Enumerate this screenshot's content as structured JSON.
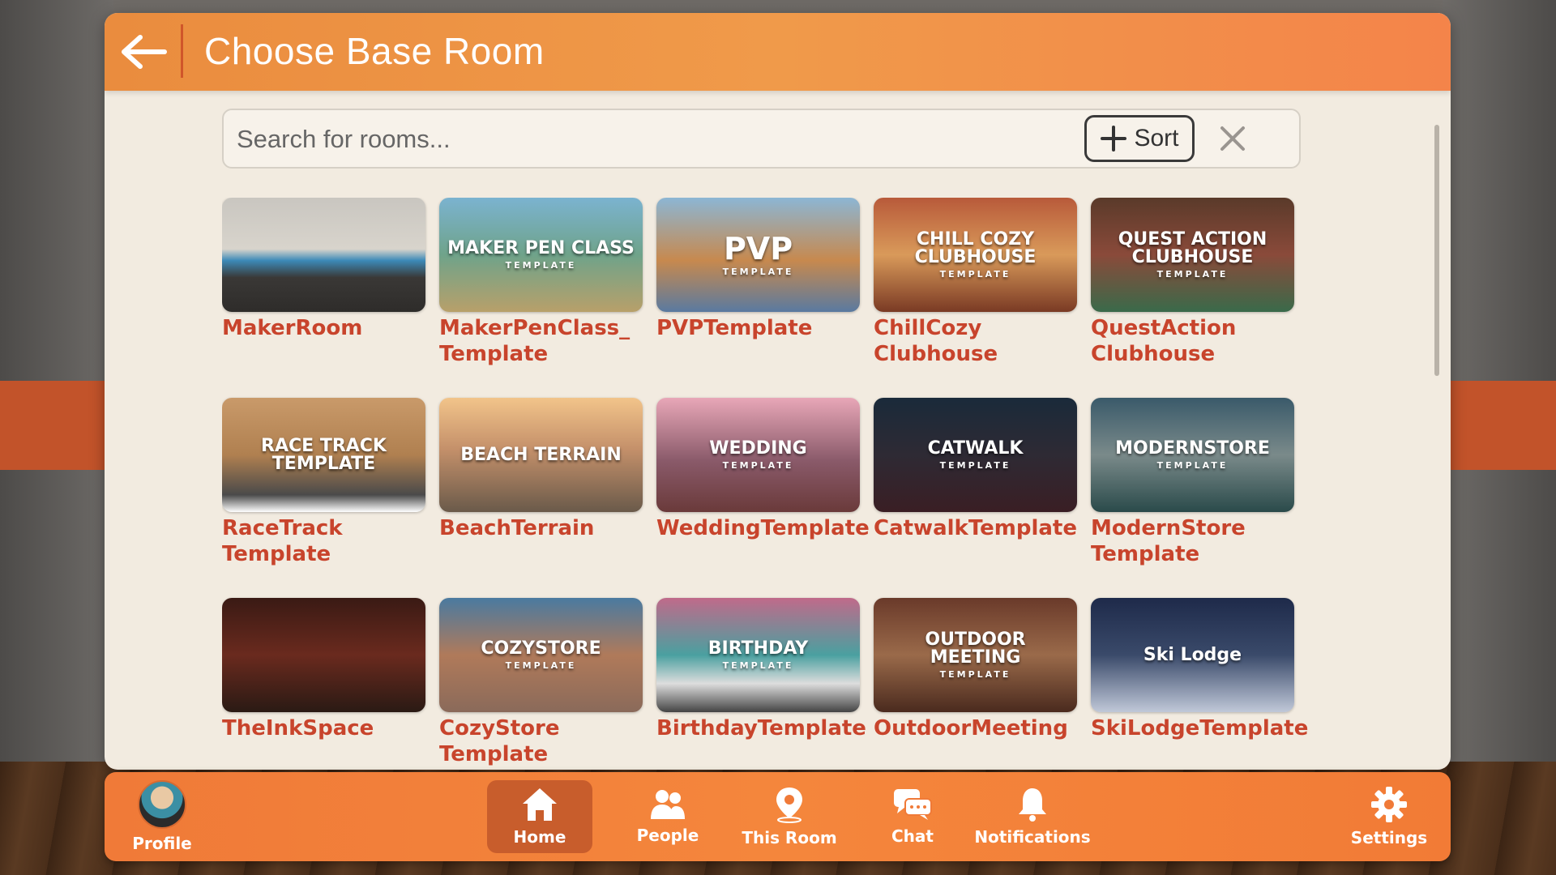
{
  "header": {
    "title": "Choose Base Room"
  },
  "search": {
    "placeholder": "Search for rooms...",
    "sort_label": "Sort"
  },
  "rooms": [
    {
      "name": "MakerRoom",
      "thumb_lines": [],
      "thumb_small": ""
    },
    {
      "name": "MakerPenClass_\nTemplate",
      "thumb_lines": [
        "MAKER PEN CLASS"
      ],
      "thumb_small": "TEMPLATE"
    },
    {
      "name": "PVPTemplate",
      "thumb_lines": [
        "PVP"
      ],
      "thumb_small": "TEMPLATE"
    },
    {
      "name": "ChillCozy\nClubhouse",
      "thumb_lines": [
        "CHILL COZY",
        "CLUBHOUSE"
      ],
      "thumb_small": "TEMPLATE"
    },
    {
      "name": "QuestAction\nClubhouse",
      "thumb_lines": [
        "QUEST ACTION",
        "CLUBHOUSE"
      ],
      "thumb_small": "TEMPLATE"
    },
    {
      "name": "RaceTrack\nTemplate",
      "thumb_lines": [
        "RACE TRACK",
        "TEMPLATE"
      ],
      "thumb_small": ""
    },
    {
      "name": "BeachTerrain",
      "thumb_lines": [
        "BEACH TERRAIN"
      ],
      "thumb_small": ""
    },
    {
      "name": "WeddingTemplate",
      "thumb_lines": [
        "WEDDING"
      ],
      "thumb_small": "TEMPLATE"
    },
    {
      "name": "CatwalkTemplate",
      "thumb_lines": [
        "CATWALK"
      ],
      "thumb_small": "TEMPLATE"
    },
    {
      "name": "ModernStore\nTemplate",
      "thumb_lines": [
        "MODERNSTORE"
      ],
      "thumb_small": "TEMPLATE"
    },
    {
      "name": "TheInkSpace",
      "thumb_lines": [],
      "thumb_small": ""
    },
    {
      "name": "CozyStore\nTemplate",
      "thumb_lines": [
        "COZYSTORE"
      ],
      "thumb_small": "TEMPLATE"
    },
    {
      "name": "BirthdayTemplate",
      "thumb_lines": [
        "BIRTHDAY"
      ],
      "thumb_small": "TEMPLATE"
    },
    {
      "name": "OutdoorMeeting",
      "thumb_lines": [
        "OUTDOOR",
        "MEETING"
      ],
      "thumb_small": "TEMPLATE"
    },
    {
      "name": "SkiLodgeTemplate",
      "thumb_lines": [
        "Ski Lodge"
      ],
      "thumb_small": ""
    }
  ],
  "nav": {
    "profile": "Profile",
    "home": "Home",
    "people": "People",
    "this_room": "This Room",
    "chat": "Chat",
    "notifications": "Notifications",
    "settings": "Settings"
  },
  "colors": {
    "accent": "#f08a3e",
    "room_name": "#c8442c",
    "panel_bg": "#f2ebe0"
  }
}
